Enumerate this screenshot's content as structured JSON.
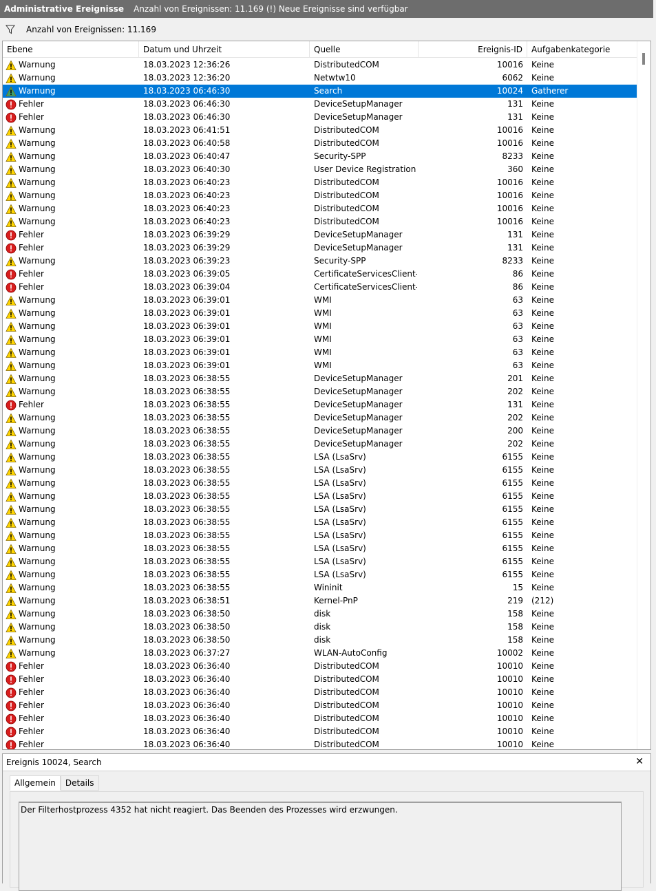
{
  "title": {
    "name": "Administrative Ereignisse",
    "info": "Anzahl von Ereignissen: 11.169 (!) Neue Ereignisse sind verfügbar"
  },
  "count_label": "Anzahl von Ereignissen: 11.169",
  "columns": {
    "level": "Ebene",
    "datetime": "Datum und Uhrzeit",
    "source": "Quelle",
    "event_id": "Ereignis-ID",
    "category": "Aufgabenkategorie"
  },
  "selected_row_index": 2,
  "rows": [
    {
      "icon": "warning",
      "level": "Warnung",
      "datetime": "18.03.2023 12:36:26",
      "source": "DistributedCOM",
      "event_id": "10016",
      "category": "Keine"
    },
    {
      "icon": "warning",
      "level": "Warnung",
      "datetime": "18.03.2023 12:36:20",
      "source": "Netwtw10",
      "event_id": "6062",
      "category": "Keine"
    },
    {
      "icon": "warning",
      "level": "Warnung",
      "datetime": "18.03.2023 06:46:30",
      "source": "Search",
      "event_id": "10024",
      "category": "Gatherer"
    },
    {
      "icon": "error",
      "level": "Fehler",
      "datetime": "18.03.2023 06:46:30",
      "source": "DeviceSetupManager",
      "event_id": "131",
      "category": "Keine"
    },
    {
      "icon": "error",
      "level": "Fehler",
      "datetime": "18.03.2023 06:46:30",
      "source": "DeviceSetupManager",
      "event_id": "131",
      "category": "Keine"
    },
    {
      "icon": "warning",
      "level": "Warnung",
      "datetime": "18.03.2023 06:41:51",
      "source": "DistributedCOM",
      "event_id": "10016",
      "category": "Keine"
    },
    {
      "icon": "warning",
      "level": "Warnung",
      "datetime": "18.03.2023 06:40:58",
      "source": "DistributedCOM",
      "event_id": "10016",
      "category": "Keine"
    },
    {
      "icon": "warning",
      "level": "Warnung",
      "datetime": "18.03.2023 06:40:47",
      "source": "Security-SPP",
      "event_id": "8233",
      "category": "Keine"
    },
    {
      "icon": "warning",
      "level": "Warnung",
      "datetime": "18.03.2023 06:40:30",
      "source": "User Device Registration",
      "event_id": "360",
      "category": "Keine"
    },
    {
      "icon": "warning",
      "level": "Warnung",
      "datetime": "18.03.2023 06:40:23",
      "source": "DistributedCOM",
      "event_id": "10016",
      "category": "Keine"
    },
    {
      "icon": "warning",
      "level": "Warnung",
      "datetime": "18.03.2023 06:40:23",
      "source": "DistributedCOM",
      "event_id": "10016",
      "category": "Keine"
    },
    {
      "icon": "warning",
      "level": "Warnung",
      "datetime": "18.03.2023 06:40:23",
      "source": "DistributedCOM",
      "event_id": "10016",
      "category": "Keine"
    },
    {
      "icon": "warning",
      "level": "Warnung",
      "datetime": "18.03.2023 06:40:23",
      "source": "DistributedCOM",
      "event_id": "10016",
      "category": "Keine"
    },
    {
      "icon": "error",
      "level": "Fehler",
      "datetime": "18.03.2023 06:39:29",
      "source": "DeviceSetupManager",
      "event_id": "131",
      "category": "Keine"
    },
    {
      "icon": "error",
      "level": "Fehler",
      "datetime": "18.03.2023 06:39:29",
      "source": "DeviceSetupManager",
      "event_id": "131",
      "category": "Keine"
    },
    {
      "icon": "warning",
      "level": "Warnung",
      "datetime": "18.03.2023 06:39:23",
      "source": "Security-SPP",
      "event_id": "8233",
      "category": "Keine"
    },
    {
      "icon": "error",
      "level": "Fehler",
      "datetime": "18.03.2023 06:39:05",
      "source": "CertificateServicesClient-...",
      "event_id": "86",
      "category": "Keine"
    },
    {
      "icon": "error",
      "level": "Fehler",
      "datetime": "18.03.2023 06:39:04",
      "source": "CertificateServicesClient-...",
      "event_id": "86",
      "category": "Keine"
    },
    {
      "icon": "warning",
      "level": "Warnung",
      "datetime": "18.03.2023 06:39:01",
      "source": "WMI",
      "event_id": "63",
      "category": "Keine"
    },
    {
      "icon": "warning",
      "level": "Warnung",
      "datetime": "18.03.2023 06:39:01",
      "source": "WMI",
      "event_id": "63",
      "category": "Keine"
    },
    {
      "icon": "warning",
      "level": "Warnung",
      "datetime": "18.03.2023 06:39:01",
      "source": "WMI",
      "event_id": "63",
      "category": "Keine"
    },
    {
      "icon": "warning",
      "level": "Warnung",
      "datetime": "18.03.2023 06:39:01",
      "source": "WMI",
      "event_id": "63",
      "category": "Keine"
    },
    {
      "icon": "warning",
      "level": "Warnung",
      "datetime": "18.03.2023 06:39:01",
      "source": "WMI",
      "event_id": "63",
      "category": "Keine"
    },
    {
      "icon": "warning",
      "level": "Warnung",
      "datetime": "18.03.2023 06:39:01",
      "source": "WMI",
      "event_id": "63",
      "category": "Keine"
    },
    {
      "icon": "warning",
      "level": "Warnung",
      "datetime": "18.03.2023 06:38:55",
      "source": "DeviceSetupManager",
      "event_id": "201",
      "category": "Keine"
    },
    {
      "icon": "warning",
      "level": "Warnung",
      "datetime": "18.03.2023 06:38:55",
      "source": "DeviceSetupManager",
      "event_id": "202",
      "category": "Keine"
    },
    {
      "icon": "error",
      "level": "Fehler",
      "datetime": "18.03.2023 06:38:55",
      "source": "DeviceSetupManager",
      "event_id": "131",
      "category": "Keine"
    },
    {
      "icon": "warning",
      "level": "Warnung",
      "datetime": "18.03.2023 06:38:55",
      "source": "DeviceSetupManager",
      "event_id": "202",
      "category": "Keine"
    },
    {
      "icon": "warning",
      "level": "Warnung",
      "datetime": "18.03.2023 06:38:55",
      "source": "DeviceSetupManager",
      "event_id": "200",
      "category": "Keine"
    },
    {
      "icon": "warning",
      "level": "Warnung",
      "datetime": "18.03.2023 06:38:55",
      "source": "DeviceSetupManager",
      "event_id": "202",
      "category": "Keine"
    },
    {
      "icon": "warning",
      "level": "Warnung",
      "datetime": "18.03.2023 06:38:55",
      "source": "LSA (LsaSrv)",
      "event_id": "6155",
      "category": "Keine"
    },
    {
      "icon": "warning",
      "level": "Warnung",
      "datetime": "18.03.2023 06:38:55",
      "source": "LSA (LsaSrv)",
      "event_id": "6155",
      "category": "Keine"
    },
    {
      "icon": "warning",
      "level": "Warnung",
      "datetime": "18.03.2023 06:38:55",
      "source": "LSA (LsaSrv)",
      "event_id": "6155",
      "category": "Keine"
    },
    {
      "icon": "warning",
      "level": "Warnung",
      "datetime": "18.03.2023 06:38:55",
      "source": "LSA (LsaSrv)",
      "event_id": "6155",
      "category": "Keine"
    },
    {
      "icon": "warning",
      "level": "Warnung",
      "datetime": "18.03.2023 06:38:55",
      "source": "LSA (LsaSrv)",
      "event_id": "6155",
      "category": "Keine"
    },
    {
      "icon": "warning",
      "level": "Warnung",
      "datetime": "18.03.2023 06:38:55",
      "source": "LSA (LsaSrv)",
      "event_id": "6155",
      "category": "Keine"
    },
    {
      "icon": "warning",
      "level": "Warnung",
      "datetime": "18.03.2023 06:38:55",
      "source": "LSA (LsaSrv)",
      "event_id": "6155",
      "category": "Keine"
    },
    {
      "icon": "warning",
      "level": "Warnung",
      "datetime": "18.03.2023 06:38:55",
      "source": "LSA (LsaSrv)",
      "event_id": "6155",
      "category": "Keine"
    },
    {
      "icon": "warning",
      "level": "Warnung",
      "datetime": "18.03.2023 06:38:55",
      "source": "LSA (LsaSrv)",
      "event_id": "6155",
      "category": "Keine"
    },
    {
      "icon": "warning",
      "level": "Warnung",
      "datetime": "18.03.2023 06:38:55",
      "source": "LSA (LsaSrv)",
      "event_id": "6155",
      "category": "Keine"
    },
    {
      "icon": "warning",
      "level": "Warnung",
      "datetime": "18.03.2023 06:38:55",
      "source": "Wininit",
      "event_id": "15",
      "category": "Keine"
    },
    {
      "icon": "warning",
      "level": "Warnung",
      "datetime": "18.03.2023 06:38:51",
      "source": "Kernel-PnP",
      "event_id": "219",
      "category": "(212)"
    },
    {
      "icon": "warning",
      "level": "Warnung",
      "datetime": "18.03.2023 06:38:50",
      "source": "disk",
      "event_id": "158",
      "category": "Keine"
    },
    {
      "icon": "warning",
      "level": "Warnung",
      "datetime": "18.03.2023 06:38:50",
      "source": "disk",
      "event_id": "158",
      "category": "Keine"
    },
    {
      "icon": "warning",
      "level": "Warnung",
      "datetime": "18.03.2023 06:38:50",
      "source": "disk",
      "event_id": "158",
      "category": "Keine"
    },
    {
      "icon": "warning",
      "level": "Warnung",
      "datetime": "18.03.2023 06:37:27",
      "source": "WLAN-AutoConfig",
      "event_id": "10002",
      "category": "Keine"
    },
    {
      "icon": "error",
      "level": "Fehler",
      "datetime": "18.03.2023 06:36:40",
      "source": "DistributedCOM",
      "event_id": "10010",
      "category": "Keine"
    },
    {
      "icon": "error",
      "level": "Fehler",
      "datetime": "18.03.2023 06:36:40",
      "source": "DistributedCOM",
      "event_id": "10010",
      "category": "Keine"
    },
    {
      "icon": "error",
      "level": "Fehler",
      "datetime": "18.03.2023 06:36:40",
      "source": "DistributedCOM",
      "event_id": "10010",
      "category": "Keine"
    },
    {
      "icon": "error",
      "level": "Fehler",
      "datetime": "18.03.2023 06:36:40",
      "source": "DistributedCOM",
      "event_id": "10010",
      "category": "Keine"
    },
    {
      "icon": "error",
      "level": "Fehler",
      "datetime": "18.03.2023 06:36:40",
      "source": "DistributedCOM",
      "event_id": "10010",
      "category": "Keine"
    },
    {
      "icon": "error",
      "level": "Fehler",
      "datetime": "18.03.2023 06:36:40",
      "source": "DistributedCOM",
      "event_id": "10010",
      "category": "Keine"
    },
    {
      "icon": "error",
      "level": "Fehler",
      "datetime": "18.03.2023 06:36:40",
      "source": "DistributedCOM",
      "event_id": "10010",
      "category": "Keine"
    }
  ],
  "detail": {
    "title": "Ereignis 10024, Search",
    "close": "✕",
    "tabs": [
      "Allgemein",
      "Details"
    ],
    "active_tab": "Allgemein",
    "message": "Der Filterhostprozess 4352 hat nicht reagiert. Das Beenden des Prozesses wird erzwungen."
  },
  "colors": {
    "titlebar": "#6d6d6d",
    "selection": "#0078d7",
    "warning_fill": "#ffd500",
    "error_fill": "#d81e1e"
  }
}
